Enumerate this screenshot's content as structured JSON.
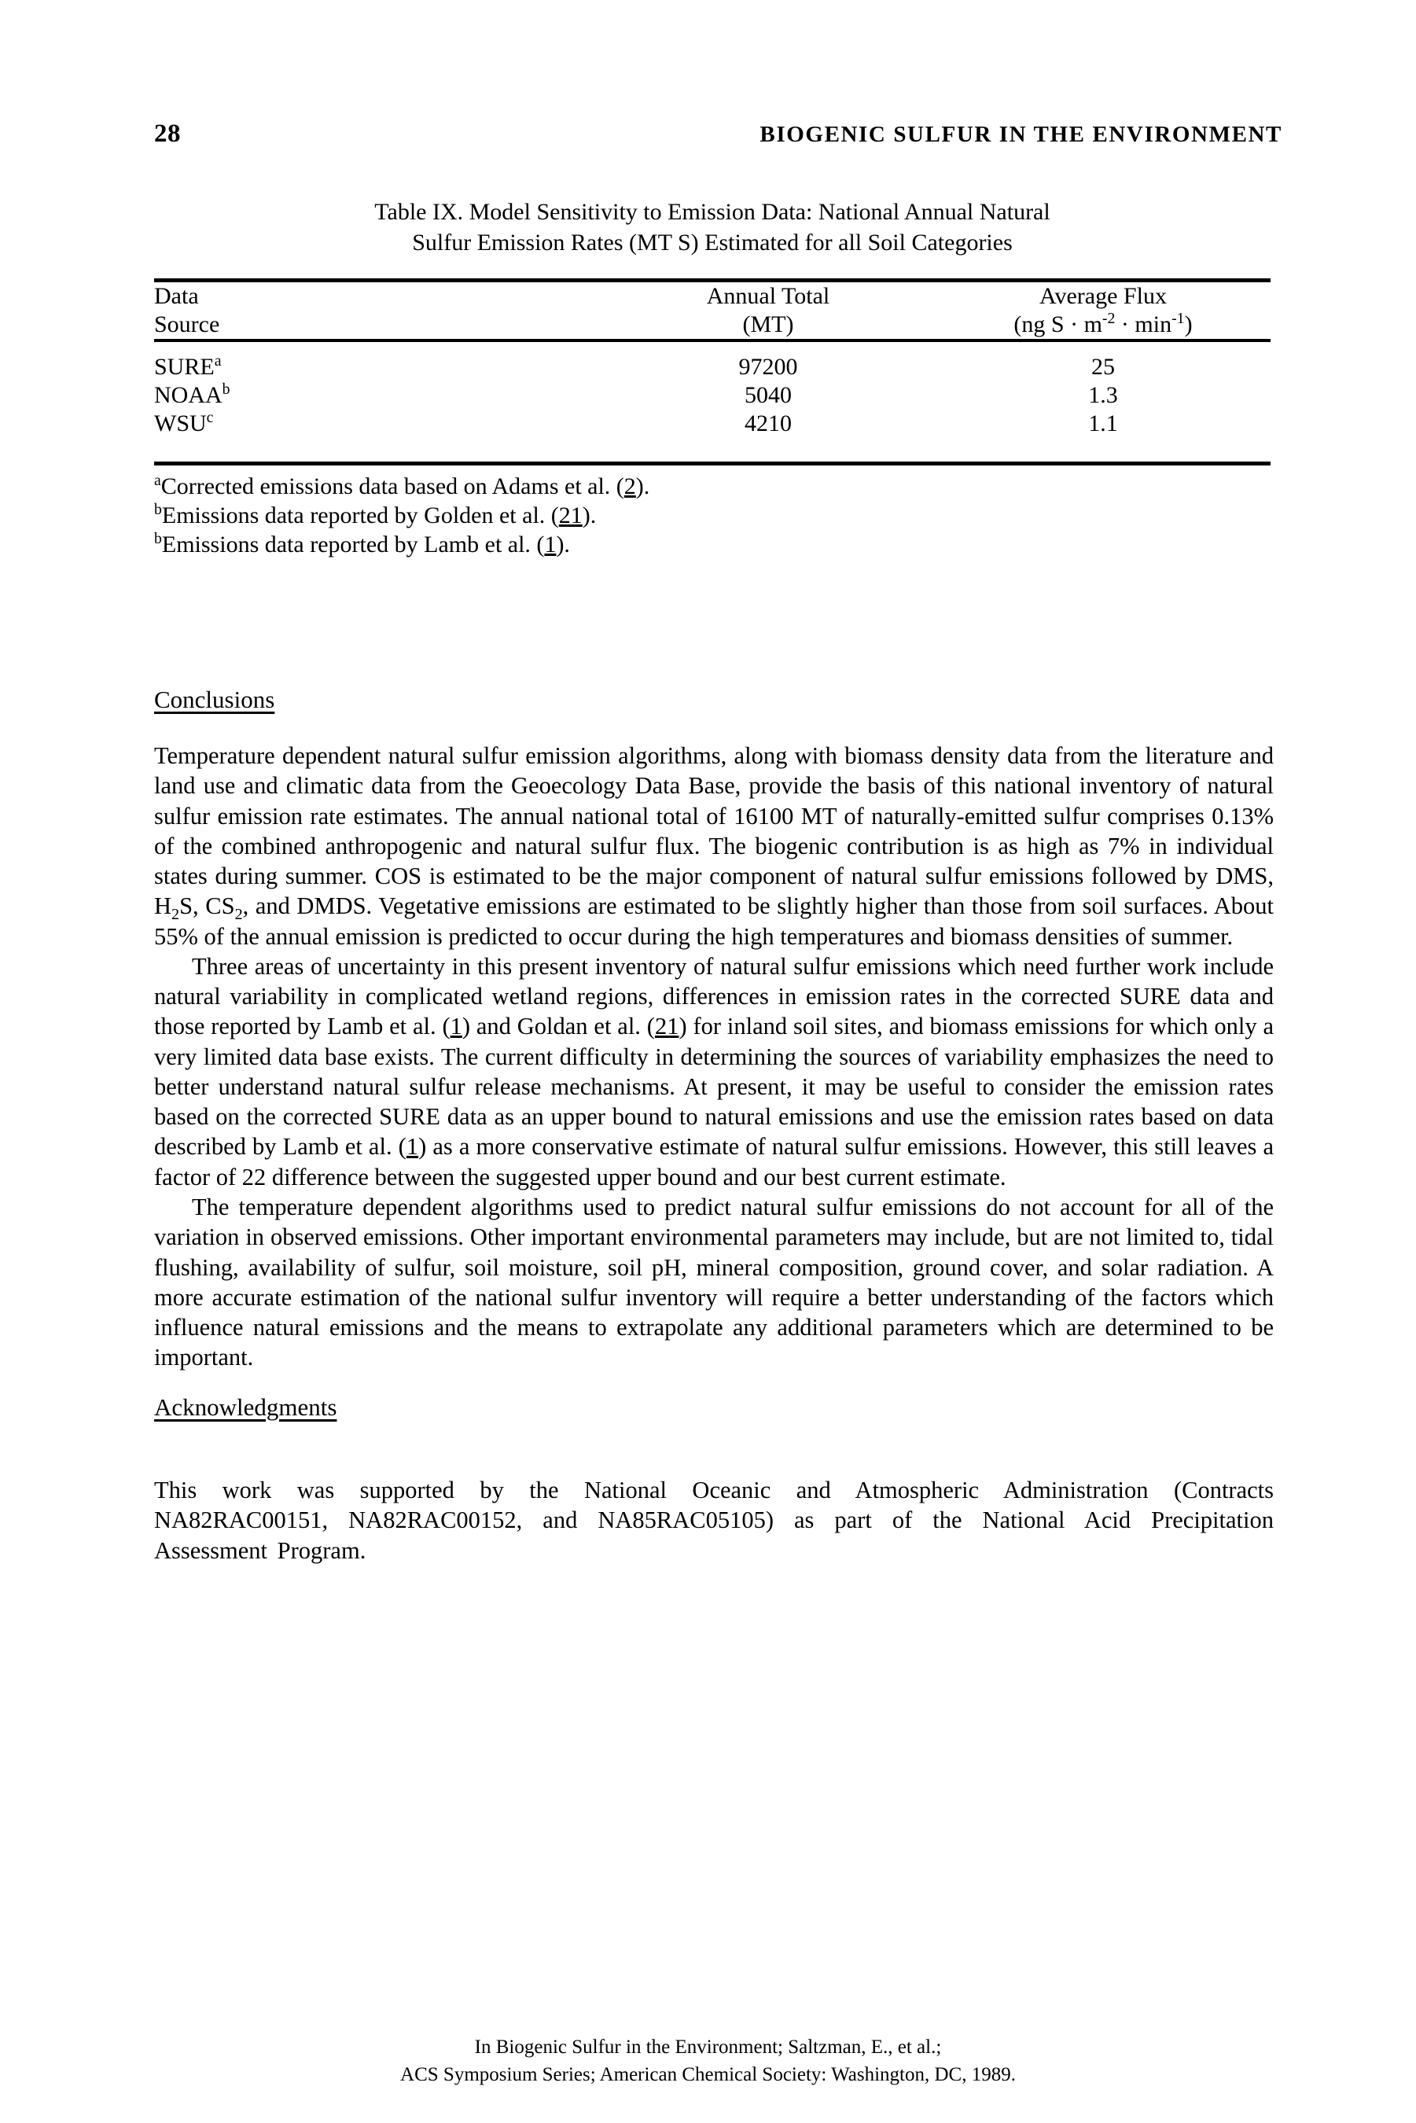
{
  "running_head": {
    "page_number": "28",
    "book_title": "BIOGENIC SULFUR IN THE ENVIRONMENT"
  },
  "table": {
    "caption_line1": "Table IX.  Model Sensitivity to Emission Data:  National Annual Natural",
    "caption_line2": "Sulfur Emission Rates (MT S) Estimated for all Soil Categories",
    "headers": {
      "col1_line1": "Data",
      "col1_line2": "Source",
      "col2_line1": "Annual Total",
      "col2_line2": "(MT)",
      "col3_line1": "Average Flux",
      "col3_units_prefix": "(ng S · m",
      "col3_units_sup1": "-2",
      "col3_units_mid": " · min",
      "col3_units_sup2": "-1",
      "col3_units_suffix": ")"
    },
    "rows": [
      {
        "source": "SURE",
        "source_note": "a",
        "annual_total": "97200",
        "average_flux": "25"
      },
      {
        "source": "NOAA",
        "source_note": "b",
        "annual_total": "5040",
        "average_flux": "1.3"
      },
      {
        "source": "WSU",
        "source_note": "c",
        "annual_total": "4210",
        "average_flux": "1.1"
      }
    ],
    "footnotes": [
      {
        "marker": "a",
        "text_before": "Corrected emissions data based on Adams et al. (",
        "ref": "2",
        "text_after": ")."
      },
      {
        "marker": "b",
        "text_before": "Emissions data reported by Golden et al. (",
        "ref": "21",
        "text_after": ")."
      },
      {
        "marker": "b",
        "text_before": "Emissions data reported by Lamb et al. (",
        "ref": "1",
        "text_after": ")."
      }
    ]
  },
  "conclusions": {
    "heading": "Conclusions",
    "paragraph1_part1": "Temperature dependent natural sulfur emission algorithms, along with biomass density data from the literature and land use and climatic data from the Geoecology Data Base, provide the basis of this national inventory of natural sulfur emission rate estimates.  The annual national total of 16100 MT of naturally-emitted sulfur comprises 0.13% of the combined anthropogenic and natural sulfur flux.  The biogenic contribution is as high as 7% in individual states during summer.  COS is estimated to be the major component of natural sulfur emissions followed by DMS, H",
    "paragraph1_sub1": "2",
    "paragraph1_part2": "S, CS",
    "paragraph1_sub2": "2",
    "paragraph1_part3": ", and DMDS.  Vegetative emissions are estimated to be slightly higher than those from soil surfaces.  About 55% of the annual emission is predicted to occur during the high temperatures and biomass densities of summer.",
    "paragraph2_part1": "Three areas of uncertainty in this present inventory of natural sulfur emissions which need further work include natural variability in complicated wetland regions, differences in emission rates in the corrected SURE data and those reported by Lamb et al. (",
    "paragraph2_ref1": "1",
    "paragraph2_part2": ") and Goldan et al. (",
    "paragraph2_ref2": "21",
    "paragraph2_part3": ") for inland soil sites, and biomass emissions for which only a very limited data base exists.  The current difficulty in determining the sources of variability emphasizes the need to better understand natural sulfur release mechanisms.  At present, it may be useful to consider the emission rates based on the corrected SURE data as an upper bound to natural emissions and use the emission rates based on data described by Lamb et al. (",
    "paragraph2_ref3": "1",
    "paragraph2_part4": ") as a more conservative estimate of natural sulfur emissions.  However, this still leaves a factor of 22 difference between the suggested upper bound and our best current estimate.",
    "paragraph3": "The temperature dependent algorithms used to predict natural sulfur emissions do not account for all of the variation in observed emissions.  Other important environmental parameters may include, but are not limited to, tidal flushing, availability of sulfur, soil moisture, soil pH, mineral composition, ground cover, and solar radiation.   A more accurate estimation of the national sulfur inventory will require a better understanding of the factors which influence natural emissions and the means to extrapolate any additional parameters which are determined to be important."
  },
  "acknowledgments": {
    "heading": "Acknowledgments",
    "paragraph": "This work was supported by the National Oceanic and Atmospheric Administration (Contracts NA82RAC00151, NA82RAC00152, and NA85RAC05105) as part of the National Acid Precipitation Assessment Program."
  },
  "footer": {
    "line1": "In Biogenic Sulfur in the Environment; Saltzman, E., et al.;",
    "line2": "ACS Symposium Series; American Chemical Society: Washington, DC, 1989."
  }
}
